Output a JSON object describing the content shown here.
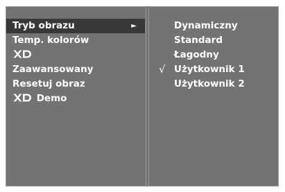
{
  "left_menu": {
    "items": [
      {
        "label": "Tryb obrazu",
        "has_arrow": true,
        "selected": true
      },
      {
        "label": "Temp. kolorów"
      },
      {
        "logo": "XD"
      },
      {
        "label": "Zaawansowany"
      },
      {
        "label": "Resetuj obraz"
      },
      {
        "logo": "XD",
        "label": "Demo"
      }
    ],
    "arrow_glyph": "►"
  },
  "right_menu": {
    "items": [
      {
        "label": "Dynamiczny"
      },
      {
        "label": "Standard"
      },
      {
        "label": "Łagodny"
      },
      {
        "label": "Użytkownik 1",
        "checked": true
      },
      {
        "label": "Użytkownik 2"
      }
    ],
    "check_glyph": "√"
  },
  "colors": {
    "panel_bg": "#737373",
    "selected_bg": "#383838",
    "text": "#ffffff"
  }
}
